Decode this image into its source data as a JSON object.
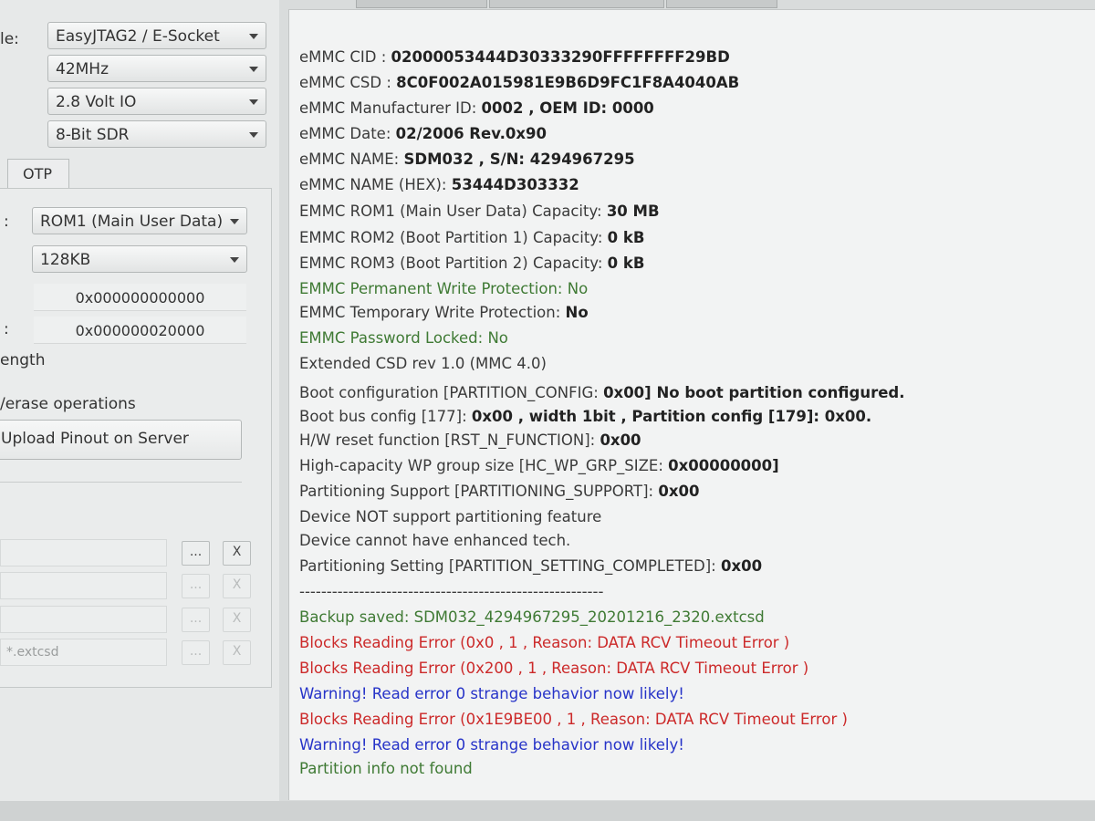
{
  "settings": {
    "mode_label": "le:",
    "interface": "EasyJTAG2 / E-Socket",
    "frequency": "42MHz",
    "voltage": "2.8 Volt IO",
    "bus_mode": "8-Bit SDR"
  },
  "tabs": {
    "otp_label": "OTP"
  },
  "memory": {
    "partition_label": ":",
    "partition": "ROM1 (Main User Data)",
    "size": "128KB",
    "start_address": "0x000000000000",
    "end_address_label": ":",
    "end_address": "0x000000020000",
    "length_label": "ength",
    "erase_label": "/erase operations",
    "upload_button": "Upload Pinout on Server"
  },
  "file_rows": [
    {
      "value": "",
      "browse_label": "...",
      "clear_label": "X",
      "enabled": true
    },
    {
      "value": "",
      "browse_label": "...",
      "clear_label": "X",
      "enabled": false
    },
    {
      "value": "",
      "browse_label": "...",
      "clear_label": "X",
      "enabled": false
    },
    {
      "value": "*.extcsd",
      "browse_label": "...",
      "clear_label": "X",
      "enabled": false
    }
  ],
  "log": [
    {
      "label": "eMMC CID : ",
      "value": "02000053444D30333290FFFFFFFF29BD",
      "color": "default"
    },
    {
      "label": "eMMC CSD : ",
      "value": "8C0F002A015981E9B6D9FC1F8A4040AB",
      "color": "default"
    },
    {
      "label": "eMMC Manufacturer ID: ",
      "value": "0002 , OEM ID: 0000",
      "color": "default"
    },
    {
      "label": "eMMC Date: ",
      "value": "02/2006  Rev.0x90",
      "color": "default"
    },
    {
      "label": "eMMC NAME: ",
      "value": "SDM032 , S/N: 4294967295",
      "color": "default"
    },
    {
      "label": "eMMC NAME (HEX): ",
      "value": "53444D303332",
      "color": "default"
    },
    {
      "label": "EMMC ROM1 (Main User Data)   Capacity: ",
      "value": "30 MB",
      "color": "default"
    },
    {
      "label": "EMMC ROM2 (Boot Partition 1) Capacity: ",
      "value": "0 kB",
      "color": "default"
    },
    {
      "label": "EMMC ROM3 (Boot Partition 2) Capacity: ",
      "value": "0 kB",
      "color": "default"
    },
    {
      "label": "EMMC Permanent Write Protection: No",
      "value": "",
      "color": "green"
    },
    {
      "label": "EMMC Temporary Write Protection: ",
      "value": "No",
      "color": "default"
    },
    {
      "label": "EMMC Password Locked: No",
      "value": "",
      "color": "green"
    },
    {
      "label": " Extended CSD rev 1.0 (MMC 4.0)",
      "value": "",
      "color": "default"
    },
    {
      "label": "Boot configuration [PARTITION_CONFIG: ",
      "value": "0x00] No boot partition configured.",
      "color": "default"
    },
    {
      "label": "Boot bus config [177]: ",
      "value": "0x00 , width 1bit  , Partition config [179]: 0x00.",
      "color": "default"
    },
    {
      "label": "H/W reset function [RST_N_FUNCTION]: ",
      "value": "0x00",
      "color": "default"
    },
    {
      "label": "High-capacity WP group size [HC_WP_GRP_SIZE: ",
      "value": "0x00000000]",
      "color": "default"
    },
    {
      "label": "Partitioning Support [PARTITIONING_SUPPORT]: ",
      "value": "0x00",
      "color": "default"
    },
    {
      "label": " Device NOT support partitioning feature",
      "value": "",
      "color": "default"
    },
    {
      "label": " Device cannot have enhanced tech.",
      "value": "",
      "color": "default"
    },
    {
      "label": "Partitioning Setting [PARTITION_SETTING_COMPLETED]: ",
      "value": "0x00",
      "color": "default"
    },
    {
      "label": "--------------------------------------------------------",
      "value": "",
      "color": "default"
    },
    {
      "label": "Backup saved: SDM032_4294967295_20201216_2320.extcsd",
      "value": "",
      "color": "green"
    },
    {
      "label": "Blocks Reading Error (0x0 , 1 , Reason: DATA RCV Timeout Error )",
      "value": "",
      "color": "red"
    },
    {
      "label": "Blocks Reading Error (0x200 , 1 , Reason: DATA RCV Timeout Error )",
      "value": "",
      "color": "red"
    },
    {
      "label": "Warning! Read error 0 strange behavior now likely!",
      "value": "",
      "color": "blue"
    },
    {
      "label": "Blocks Reading Error (0x1E9BE00 , 1 , Reason: DATA RCV Timeout Error )",
      "value": "",
      "color": "red"
    },
    {
      "label": "Warning! Read error 0 strange behavior now likely!",
      "value": "",
      "color": "blue"
    },
    {
      "label": "Partition info not found",
      "value": "",
      "color": "green"
    }
  ],
  "colors": {
    "green": "#3f7a34",
    "red": "#cc2a2a",
    "blue": "#2633c8"
  }
}
